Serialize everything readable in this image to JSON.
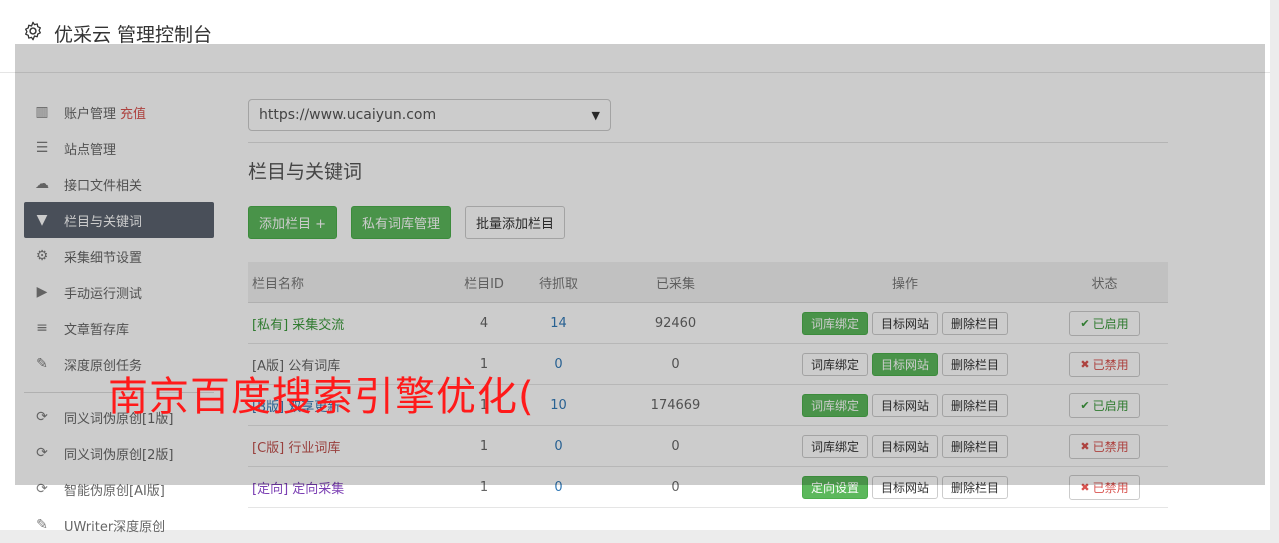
{
  "header": {
    "title": "优采云 管理控制台",
    "icon": "gear-icon"
  },
  "sidebar": {
    "items": [
      {
        "label": "账户管理",
        "accent": "充值",
        "icon": "bar-chart-icon",
        "glyph": "▥"
      },
      {
        "label": "站点管理",
        "icon": "server-icon",
        "glyph": "☰"
      },
      {
        "label": "接口文件相关",
        "icon": "cloud-upload-icon",
        "glyph": "☁"
      },
      {
        "label": "栏目与关键词",
        "icon": "filter-icon",
        "glyph": "▼",
        "active": true
      },
      {
        "label": "采集细节设置",
        "icon": "cogs-icon",
        "glyph": "⚙"
      },
      {
        "label": "手动运行测试",
        "icon": "play-circle-icon",
        "glyph": "▶"
      },
      {
        "label": "文章暂存库",
        "icon": "database-icon",
        "glyph": "≡"
      },
      {
        "label": "深度原创任务",
        "icon": "edit-icon",
        "glyph": "✎"
      },
      {
        "label": "同义词伪原创[1版]",
        "icon": "refresh-icon",
        "glyph": "⟳"
      },
      {
        "label": "同义词伪原创[2版]",
        "icon": "refresh-icon",
        "glyph": "⟳"
      },
      {
        "label": "智能伪原创[AI版]",
        "icon": "refresh-icon",
        "glyph": "⟳"
      },
      {
        "label": "UWriter深度原创",
        "icon": "edit-icon",
        "glyph": "✎"
      }
    ]
  },
  "main": {
    "site_select": "https://www.ucaiyun.com",
    "section_title": "栏目与关键词",
    "buttons": {
      "add_column": "添加栏目 +",
      "private_lexicon": "私有词库管理",
      "batch_add": "批量添加栏目"
    },
    "table": {
      "headers": [
        "栏目名称",
        "栏目ID",
        "待抓取",
        "已采集",
        "操作",
        "状态"
      ],
      "rows": [
        {
          "tag": "[私有]",
          "name": "采集交流",
          "id": "4",
          "pending": "14",
          "collected": "92460",
          "first_op": "词库绑定",
          "first_on": true,
          "target_on": false,
          "status": "已启用",
          "enabled": true,
          "color": "#3c9a3c"
        },
        {
          "tag": "[A版]",
          "name": "公有词库",
          "id": "1",
          "pending": "0",
          "collected": "0",
          "first_op": "词库绑定",
          "first_on": false,
          "target_on": true,
          "status": "已禁用",
          "enabled": false,
          "color": "#666666"
        },
        {
          "tag": "[B版]",
          "name": "双享更新",
          "id": "1",
          "pending": "10",
          "collected": "174669",
          "first_op": "词库绑定",
          "first_on": true,
          "target_on": false,
          "status": "已启用",
          "enabled": true,
          "color": "#337ab7"
        },
        {
          "tag": "[C版]",
          "name": "行业词库",
          "id": "1",
          "pending": "0",
          "collected": "0",
          "first_op": "词库绑定",
          "first_on": false,
          "target_on": false,
          "status": "已禁用",
          "enabled": false,
          "color": "#c0504d"
        },
        {
          "tag": "[定向]",
          "name": "定向采集",
          "id": "1",
          "pending": "0",
          "collected": "0",
          "first_op": "定向设置",
          "first_on": true,
          "target_on": false,
          "status": "已禁用",
          "enabled": false,
          "color": "#7b3fb3"
        }
      ],
      "target_label": "目标网站",
      "delete_label": "删除栏目"
    }
  },
  "watermark": "南京百度搜索引擎优化("
}
